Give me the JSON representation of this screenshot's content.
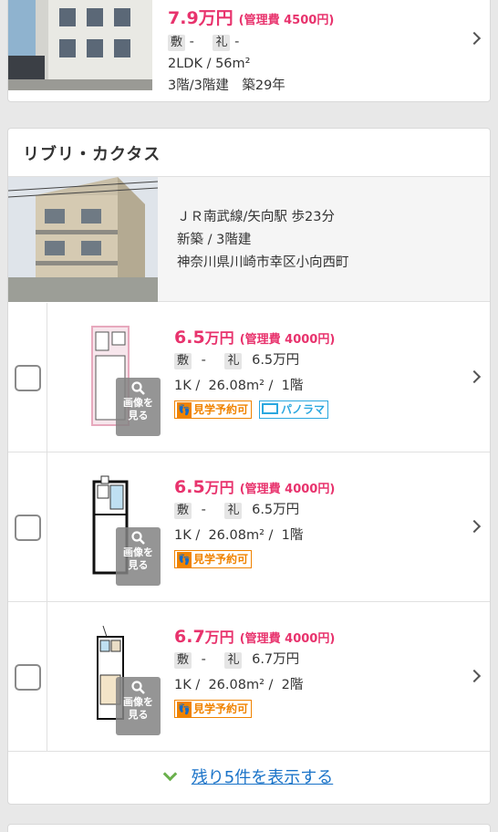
{
  "top_listing": {
    "price": "7.9万円",
    "management_fee": "(管理費 4500円)",
    "deposit_label": "敷",
    "deposit_value": "-",
    "key_money_label": "礼",
    "key_money_value": "-",
    "layout_area": "2LDK / 56m²",
    "floor": "3階/3階建",
    "age": "築29年"
  },
  "building": {
    "name": "リブリ・カクタス",
    "access": "ＪＲ南武線/矢向駅 歩23分",
    "construction": "新築 / 3階建",
    "address": "神奈川県川崎市幸区小向西町"
  },
  "image_button_label_1": "画像を",
  "image_button_label_2": "見る",
  "visit_badge": "見学予約可",
  "panorama_badge": "パノラマ",
  "deposit_label": "敷",
  "key_money_label": "礼",
  "rooms": [
    {
      "rent_number": "6.5",
      "rent_unit": "万円",
      "management_fee": "(管理費 4000円)",
      "deposit": "-",
      "key_money": "6.5万円",
      "layout": "1K",
      "area": "26.08m²",
      "floor": "1階",
      "has_panorama": true
    },
    {
      "rent_number": "6.5",
      "rent_unit": "万円",
      "management_fee": "(管理費 4000円)",
      "deposit": "-",
      "key_money": "6.5万円",
      "layout": "1K",
      "area": "26.08m²",
      "floor": "1階",
      "has_panorama": false
    },
    {
      "rent_number": "6.7",
      "rent_unit": "万円",
      "management_fee": "(管理費 4000円)",
      "deposit": "-",
      "key_money": "6.7万円",
      "layout": "1K",
      "area": "26.08m²",
      "floor": "2階",
      "has_panorama": false
    }
  ],
  "show_more_label": "残り5件を表示する",
  "colors": {
    "price": "#e8336d",
    "visit_badge": "#f08300",
    "panorama_badge": "#2aa7df",
    "link": "#1a73c8",
    "more_chevron": "#6ab04c"
  }
}
